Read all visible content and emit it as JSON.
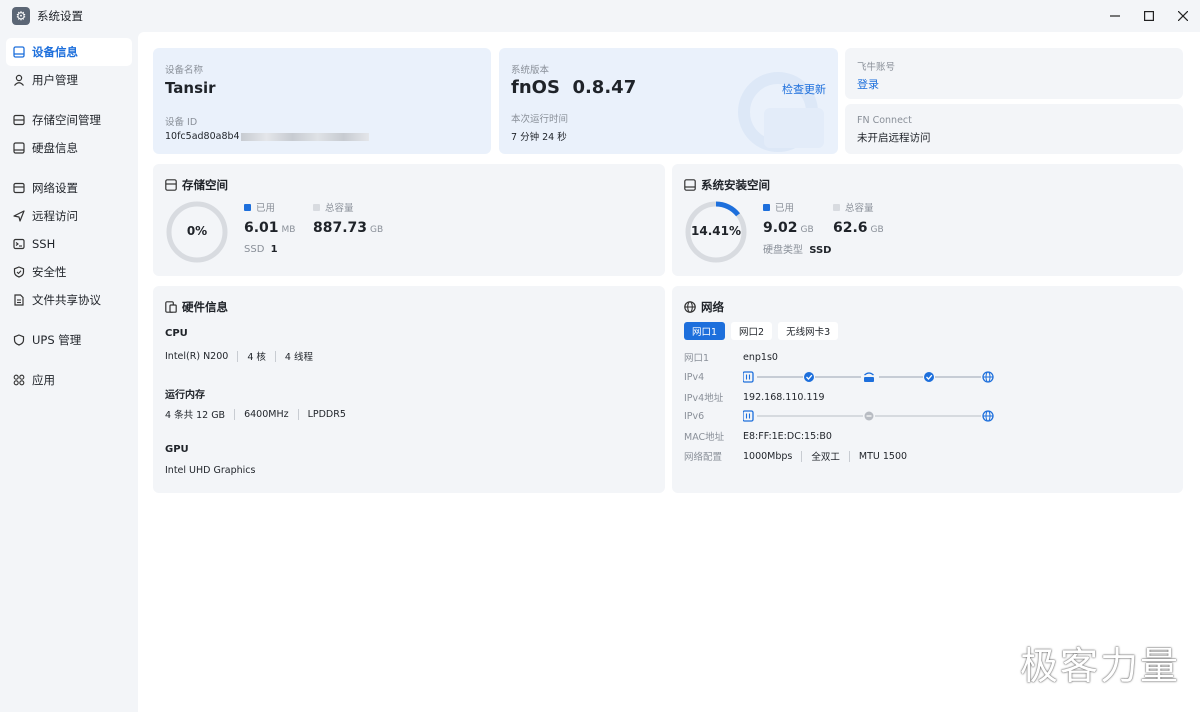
{
  "window": {
    "title": "系统设置"
  },
  "sidebar": {
    "items": [
      {
        "label": "设备信息",
        "icon": "device-icon",
        "active": true
      },
      {
        "label": "用户管理",
        "icon": "user-icon"
      },
      {
        "label": "存储空间管理",
        "icon": "storage-icon"
      },
      {
        "label": "硬盘信息",
        "icon": "disk-icon"
      },
      {
        "label": "网络设置",
        "icon": "network-icon"
      },
      {
        "label": "远程访问",
        "icon": "remote-icon"
      },
      {
        "label": "SSH",
        "icon": "terminal-icon"
      },
      {
        "label": "安全性",
        "icon": "shield-icon"
      },
      {
        "label": "文件共享协议",
        "icon": "file-share-icon"
      },
      {
        "label": "UPS 管理",
        "icon": "ups-icon"
      },
      {
        "label": "应用",
        "icon": "apps-icon"
      }
    ]
  },
  "device": {
    "name_label": "设备名称",
    "name": "Tansir",
    "id_label": "设备 ID",
    "id_value": "10fc5ad80a8b4"
  },
  "system": {
    "version_label": "系统版本",
    "version": "fnOS  0.8.47",
    "check_update": "检查更新",
    "uptime_label": "本次运行时间",
    "uptime": "7 分钟 24 秒"
  },
  "account": {
    "label": "飞牛账号",
    "login": "登录"
  },
  "fn_connect": {
    "label": "FN Connect",
    "status": "未开启远程访问"
  },
  "storage": {
    "title": "存储空间",
    "percent_text": "0%",
    "percent": 0,
    "used_label": "已用",
    "used_value": "6.01",
    "used_unit": "MB",
    "total_label": "总容量",
    "total_value": "887.73",
    "total_unit": "GB",
    "disk_type": "SSD",
    "disk_count": "1",
    "colors": {
      "used": "#1d6fdc",
      "total": "#d8dbe0"
    }
  },
  "sys_storage": {
    "title": "系统安装空间",
    "percent_text": "14.41%",
    "percent": 14.41,
    "used_label": "已用",
    "used_value": "9.02",
    "used_unit": "GB",
    "total_label": "总容量",
    "total_value": "62.6",
    "total_unit": "GB",
    "disk_type_label": "硬盘类型",
    "disk_type": "SSD"
  },
  "hardware": {
    "title": "硬件信息",
    "cpu_label": "CPU",
    "cpu_model": "Intel(R) N200",
    "cpu_cores": "4 核",
    "cpu_threads": "4 线程",
    "mem_label": "运行内存",
    "mem_size": "4 条共 12 GB",
    "mem_speed": "6400MHz",
    "mem_type": "LPDDR5",
    "gpu_label": "GPU",
    "gpu_model": "Intel UHD Graphics"
  },
  "network": {
    "title": "网络",
    "tabs": [
      "网口1",
      "网口2",
      "无线网卡3"
    ],
    "active_tab": 0,
    "port_label": "网口1",
    "port_value": "enp1s0",
    "ipv4_label": "IPv4",
    "ipv4_addr_label": "IPv4地址",
    "ipv4_addr": "192.168.110.119",
    "ipv6_label": "IPv6",
    "mac_label": "MAC地址",
    "mac": "E8:FF:1E:DC:15:B0",
    "config_label": "网络配置",
    "speed": "1000Mbps",
    "duplex": "全双工",
    "mtu": "MTU 1500",
    "colors": {
      "accent": "#1d6fdc",
      "inactive": "#b8bcc3"
    }
  },
  "watermark": "极客力量"
}
